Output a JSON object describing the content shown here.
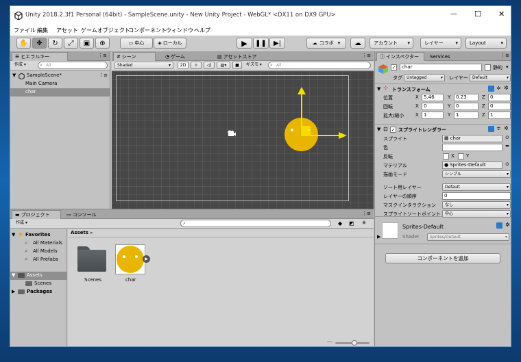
{
  "window": {
    "title": "Unity 2018.2.3f1 Personal (64bit) - SampleScene.unity - New Unity Project - WebGL* <DX11 on DX9 GPU>",
    "controls": {
      "minimize": "—",
      "maximize": "☐",
      "close": "✕"
    }
  },
  "menu": [
    "ファイル",
    "編集",
    "アセット",
    "ゲームオブジェクト",
    "コンポーネント",
    "ウィンドウ",
    "ヘルプ"
  ],
  "toolbar": {
    "pivot": "中心",
    "space": "ローカル",
    "collab": "コラボ",
    "account": "アカウント",
    "layers": "レイヤー",
    "layout": "Layout"
  },
  "hierarchy": {
    "tab": "ヒエラルキー",
    "create": "作成",
    "search_placeholder": "All",
    "scene": "SampleScene*",
    "items": [
      "Main Camera",
      "char"
    ]
  },
  "scene_view": {
    "tabs": [
      "シーン",
      "ゲーム",
      "アセットストア"
    ],
    "shading": "Shaded",
    "mode_2d": "2D",
    "gizmos": "ギズモ",
    "search_placeholder": "All"
  },
  "project": {
    "tabs": [
      "プロジェクト",
      "コンソール"
    ],
    "create": "作成",
    "favorites": "Favorites",
    "favorite_items": [
      "All Materials",
      "All Models",
      "All Prefabs"
    ],
    "assets": "Assets",
    "asset_children": [
      "Scenes"
    ],
    "packages": "Packages",
    "breadcrumb": "Assets",
    "files": [
      {
        "name": "Scenes"
      },
      {
        "name": "char"
      }
    ],
    "zoom_level": 0.55
  },
  "inspector": {
    "tabs": [
      "インスペクター",
      "Services"
    ],
    "object_name": "char",
    "static_label": "静的",
    "tag_label": "タグ",
    "tag_value": "Untagged",
    "layer_label": "レイヤー",
    "layer_value": "Default",
    "transform": {
      "title": "トランスフォーム",
      "rows": [
        {
          "label": "位置",
          "x": "5.46",
          "y": "0.23",
          "z": "0"
        },
        {
          "label": "回転",
          "x": "0",
          "y": "0",
          "z": "0"
        },
        {
          "label": "拡大/縮小",
          "x": "1",
          "y": "1",
          "z": "1"
        }
      ]
    },
    "sprite_renderer": {
      "title": "スプライトレンダラー",
      "sprite_label": "スプライト",
      "sprite_value": "char",
      "color_label": "色",
      "flip_label": "反転",
      "flip_x": "X",
      "flip_y": "Y",
      "material_label": "マテリアル",
      "material_value": "Sprites-Default",
      "draw_mode_label": "描画モード",
      "draw_mode_value": "シンプル",
      "sorting_layer_label": "ソート用レイヤー",
      "sorting_layer_value": "Default",
      "order_label": "レイヤーの順序",
      "order_value": "0",
      "mask_label": "マスクインタラクション",
      "mask_value": "なし",
      "sort_point_label": "スプライトソートポイント",
      "sort_point_value": "中心"
    },
    "material": {
      "name": "Sprites-Default",
      "shader_label": "Shader",
      "shader_value": "Sprites/Default"
    },
    "add_component": "コンポーネントを追加"
  },
  "colors": {
    "sprite": "#e8b500",
    "gizmo_y": "#f0e000",
    "selection": "#8f8f8f",
    "scene_bg": "#474747",
    "title_text": "#333333"
  }
}
